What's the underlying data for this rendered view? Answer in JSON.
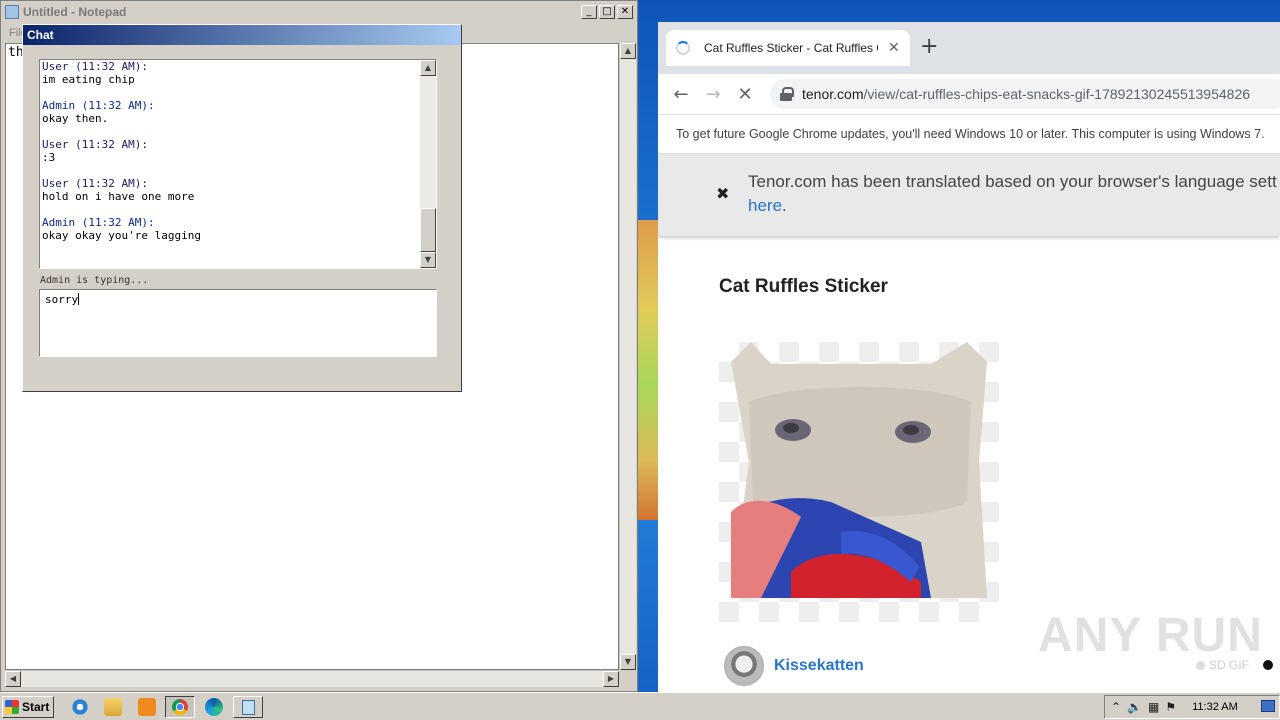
{
  "notepad": {
    "title": "Untitled - Notepad",
    "menu": [
      "File"
    ],
    "content": "th",
    "controls": {
      "minimize": "_",
      "maximize": "□",
      "close": "✕"
    }
  },
  "chat": {
    "title": "Chat",
    "messages": [
      {
        "author": "User (11:32 AM):",
        "text": "im eating chip",
        "role": "user"
      },
      {
        "author": "Admin (11:32 AM):",
        "text": "okay then.",
        "role": "admin"
      },
      {
        "author": "User (11:32 AM):",
        "text": ":3",
        "role": "user"
      },
      {
        "author": "User (11:32 AM):",
        "text": "hold on i have one more",
        "role": "user"
      },
      {
        "author": "Admin (11:32 AM):",
        "text": "okay okay you're lagging",
        "role": "admin"
      }
    ],
    "typing_status": "Admin is typing...",
    "input_value": "sorry"
  },
  "browser": {
    "tab_title": "Cat Ruffles Sticker - Cat Ruffles Chi",
    "tab_close": "✕",
    "new_tab": "+",
    "url_host": "tenor.com",
    "url_path": "/view/cat-ruffles-chips-eat-snacks-gif-17892130245513954826",
    "info_bar": "To get future Google Chrome updates, you'll need Windows 10 or later. This computer is using Windows 7.",
    "translate_text": "Tenor.com has been translated based on your browser's language sett",
    "translate_link": "here",
    "translate_period": ".",
    "page_title": "Cat Ruffles Sticker",
    "author": "Kissekatten",
    "watermark": "ANY RUN",
    "sd_label": "SD GIF"
  },
  "taskbar": {
    "start_label": "Start",
    "clock": "11:32 AM",
    "tray_icons": [
      "chevron-up-icon",
      "speaker-icon",
      "network-icon",
      "flag-icon"
    ],
    "apps": [
      "ie-icon",
      "explorer-icon",
      "media-player-icon",
      "chrome-icon",
      "edge-icon",
      "notepad-icon"
    ]
  }
}
